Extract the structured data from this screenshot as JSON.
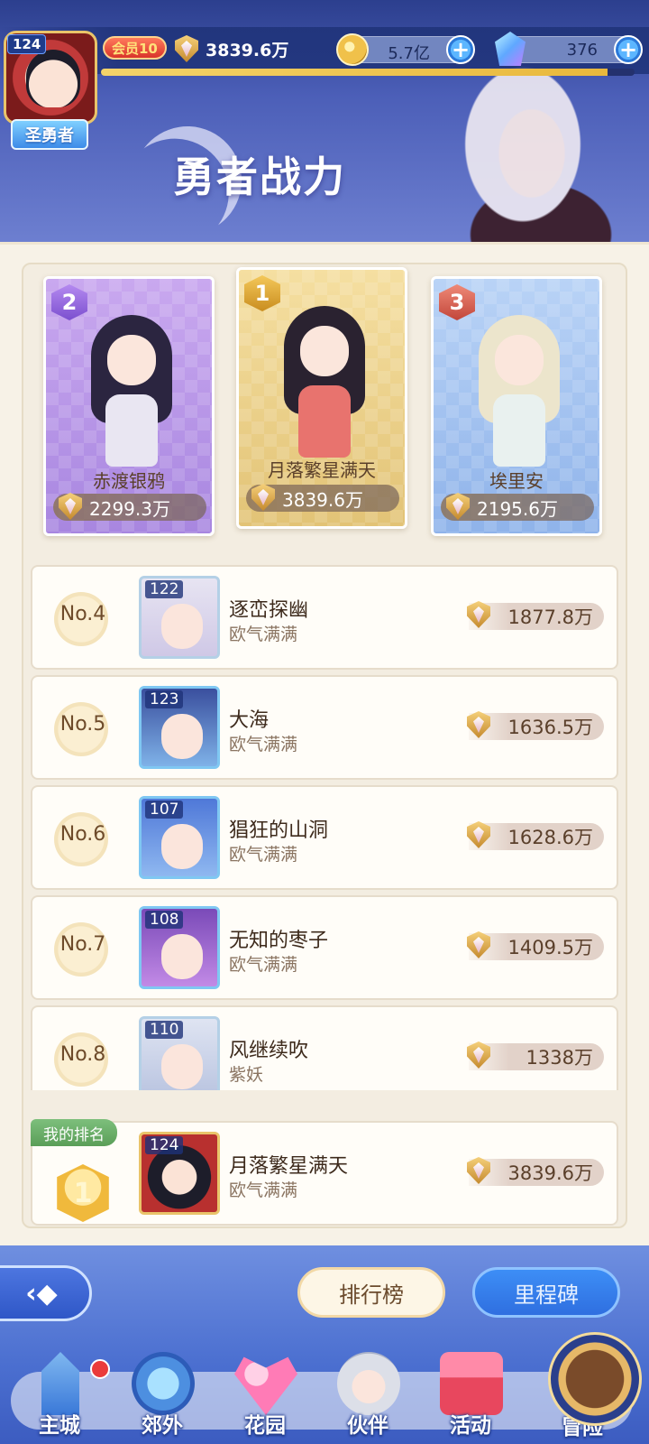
{
  "header": {
    "title": "勇者战力",
    "player_level": "124",
    "player_title": "圣勇者",
    "vip_label": "会员10",
    "power": "3839.6万",
    "gold": "5.7亿",
    "gems": "376",
    "exp_progress_percent": 95
  },
  "podium": [
    {
      "rank": "2",
      "name": "赤渡银鸦",
      "power": "2299.3万"
    },
    {
      "rank": "1",
      "name": "月落繁星满天",
      "power": "3839.6万"
    },
    {
      "rank": "3",
      "name": "埃里安",
      "power": "2195.6万"
    }
  ],
  "ranking": [
    {
      "no": "No.4",
      "level": "122",
      "name": "逐峦探幽",
      "guild": "欧气满满",
      "power": "1877.8万"
    },
    {
      "no": "No.5",
      "level": "123",
      "name": "大海",
      "guild": "欧气满满",
      "power": "1636.5万"
    },
    {
      "no": "No.6",
      "level": "107",
      "name": "猖狂的山洞",
      "guild": "欧气满满",
      "power": "1628.6万"
    },
    {
      "no": "No.7",
      "level": "108",
      "name": "无知的枣子",
      "guild": "欧气满满",
      "power": "1409.5万"
    },
    {
      "no": "No.8",
      "level": "110",
      "name": "风继续吹",
      "guild": "紫妖",
      "power": "1338万"
    }
  ],
  "my_rank": {
    "tag": "我的排名",
    "rank": "1",
    "level": "124",
    "name": "月落繁星满天",
    "guild": "欧气满满",
    "power": "3839.6万"
  },
  "tabs": {
    "leaderboard": "排行榜",
    "milestone": "里程碑"
  },
  "nav": [
    {
      "label": "主城"
    },
    {
      "label": "郊外"
    },
    {
      "label": "花园"
    },
    {
      "label": "伙伴"
    },
    {
      "label": "活动"
    },
    {
      "label": "冒险"
    }
  ],
  "colors": {
    "header_blue": "#4c5fb8",
    "panel_bg": "#f7f2e7",
    "rank1_gold": "#e2c376",
    "rank2_purple": "#a886e0",
    "rank3_blue": "#8fb3ea",
    "milestone_blue": "#2f6fe0",
    "guild_tag_green": "#5a9e58"
  },
  "icons": {
    "power": "crest-icon",
    "gold": "coin-icon",
    "gems": "gem-icon",
    "add": "plus-icon",
    "back": "back-arrow-icon"
  }
}
